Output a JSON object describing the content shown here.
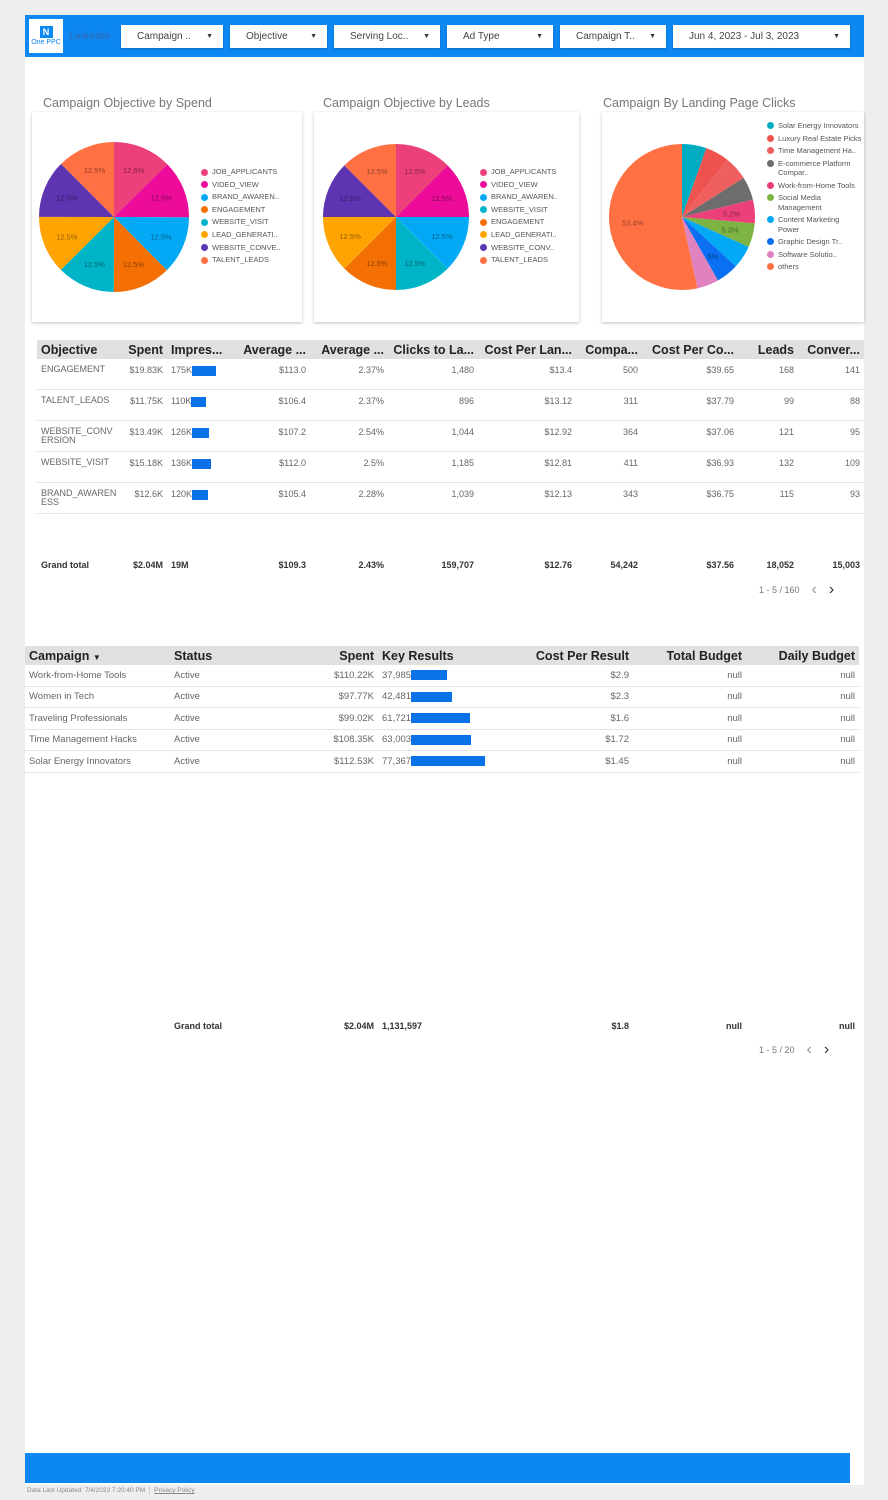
{
  "header": {
    "logo_text": "One PPC",
    "linkedin_text": "Linkedin",
    "filters": [
      "Campaign ..",
      "Objective",
      "Serving Loc..",
      "Ad Type",
      "Campaign T..",
      "Jun 4, 2023 - Jul 3, 2023"
    ],
    "brand_color": "#0d87f2"
  },
  "chart_data": [
    {
      "type": "pie",
      "title": "Campaign Objective by Spend",
      "slices": [
        {
          "label": "JOB_APPLICANTS",
          "value": 12.6,
          "display": "12.6%",
          "color": "#ec407a"
        },
        {
          "label": "VIDEO_VIEW",
          "value": 12.5,
          "display": "12.5%",
          "color": "#ec0c99"
        },
        {
          "label": "BRAND_AWAREN..",
          "value": 12.5,
          "display": "12.5%",
          "color": "#03a9f4"
        },
        {
          "label": "ENGAGEMENT",
          "value": 12.5,
          "display": "12.5%",
          "color": "#f57004"
        },
        {
          "label": "WEBSITE_VISIT",
          "value": 12.5,
          "display": "12.5%",
          "color": "#00b4c8"
        },
        {
          "label": "LEAD_GENERATI..",
          "value": 12.5,
          "display": "12.5%",
          "color": "#ffa402"
        },
        {
          "label": "WEBSITE_CONVE..",
          "value": 12.5,
          "display": "12.5%",
          "color": "#5e35b1"
        },
        {
          "label": "TALENT_LEADS",
          "value": 12.5,
          "display": "12.5%",
          "color": "#ff7043"
        }
      ]
    },
    {
      "type": "pie",
      "title": "Campaign Objective by Leads",
      "slices": [
        {
          "label": "JOB_APPLICANTS",
          "value": 12.5,
          "display": "12.5%",
          "color": "#ec407a"
        },
        {
          "label": "VIDEO_VIEW",
          "value": 12.5,
          "display": "12.5%",
          "color": "#ec0c99"
        },
        {
          "label": "BRAND_AWAREN..",
          "value": 12.5,
          "display": "12.5%",
          "color": "#03a9f4"
        },
        {
          "label": "WEBSITE_VISIT",
          "value": 12.5,
          "display": "12.5%",
          "color": "#00b4c8"
        },
        {
          "label": "ENGAGEMENT",
          "value": 12.5,
          "display": "12.5%",
          "color": "#f57004"
        },
        {
          "label": "LEAD_GENERATI..",
          "value": 12.5,
          "display": "12.5%",
          "color": "#ffa402"
        },
        {
          "label": "WEBSITE_CONV..",
          "value": 12.5,
          "display": "12.5%",
          "color": "#5e35b1"
        },
        {
          "label": "TALENT_LEADS",
          "value": 12.5,
          "display": "12.5%",
          "color": "#ff7043"
        }
      ]
    },
    {
      "type": "pie",
      "title": "Campaign By Landing Page Clicks",
      "slices": [
        {
          "label": "Solar Energy Innovators",
          "value": 5.4,
          "display": "",
          "color": "#00acc1"
        },
        {
          "label": "Luxury Real Estate Picks",
          "value": 5.3,
          "display": "",
          "color": "#ef5350"
        },
        {
          "label": "Time Management Ha..",
          "value": 5.3,
          "display": "",
          "color": "#ef5f5f"
        },
        {
          "label": "E-commerce Platform Compar..",
          "value": 5.2,
          "display": "",
          "color": "#6d6d6d"
        },
        {
          "label": "Work-from-Home Tools",
          "value": 5.2,
          "display": "5.2%",
          "color": "#ec407a"
        },
        {
          "label": "Social Media Management",
          "value": 5.3,
          "display": "5.3%",
          "color": "#7cb342"
        },
        {
          "label": "Content Marketing Power",
          "value": 5.1,
          "display": "",
          "color": "#03a9f4"
        },
        {
          "label": "Graphic Design Tr..",
          "value": 5.0,
          "display": "5%",
          "color": "#0a6ff0"
        },
        {
          "label": "Software Solutio..",
          "value": 4.8,
          "display": "",
          "color": "#e082c0"
        },
        {
          "label": "others",
          "value": 53.4,
          "display": "53.4%",
          "color": "#ff7043"
        }
      ]
    }
  ],
  "objective_table": {
    "headers": [
      "Objective",
      "Spent",
      "Impres...",
      "Average ...",
      "Average ...",
      "Clicks to La...",
      "Cost Per Lan...",
      "Compa...",
      "Cost Per Co...",
      "Leads",
      "Conver..."
    ],
    "rows": [
      {
        "objective": "ENGAGEMENT",
        "spent": "$19.83K",
        "impressions": "175K",
        "impressions_value": 175000,
        "avg1": "$113.0",
        "avg2": "2.37%",
        "clicks": "1,480",
        "cpl": "$13.4",
        "compa": "500",
        "cpc": "$39.65",
        "leads": "168",
        "conv": "141"
      },
      {
        "objective": "TALENT_LEADS",
        "spent": "$11.75K",
        "impressions": "110K",
        "impressions_value": 110000,
        "avg1": "$106.4",
        "avg2": "2.37%",
        "clicks": "896",
        "cpl": "$13.12",
        "compa": "311",
        "cpc": "$37.79",
        "leads": "99",
        "conv": "88"
      },
      {
        "objective": "WEBSITE_CONVERSION",
        "spent": "$13.49K",
        "impressions": "126K",
        "impressions_value": 126000,
        "avg1": "$107.2",
        "avg2": "2.54%",
        "clicks": "1,044",
        "cpl": "$12.92",
        "compa": "364",
        "cpc": "$37.06",
        "leads": "121",
        "conv": "95"
      },
      {
        "objective": "WEBSITE_VISIT",
        "spent": "$15.18K",
        "impressions": "136K",
        "impressions_value": 136000,
        "avg1": "$112.0",
        "avg2": "2.5%",
        "clicks": "1,185",
        "cpl": "$12.81",
        "compa": "411",
        "cpc": "$36.93",
        "leads": "132",
        "conv": "109"
      },
      {
        "objective": "BRAND_AWARENESS",
        "spent": "$12.6K",
        "impressions": "120K",
        "impressions_value": 120000,
        "avg1": "$105.4",
        "avg2": "2.28%",
        "clicks": "1,039",
        "cpl": "$12.13",
        "compa": "343",
        "cpc": "$36.75",
        "leads": "115",
        "conv": "93"
      }
    ],
    "total": {
      "label": "Grand total",
      "spent": "$2.04M",
      "impressions": "19M",
      "avg1": "$109.3",
      "avg2": "2.43%",
      "clicks": "159,707",
      "cpl": "$12.76",
      "compa": "54,242",
      "cpc": "$37.56",
      "leads": "18,052",
      "conv": "15,003"
    },
    "pagination": "1 - 5 / 160"
  },
  "campaign_table": {
    "headers": [
      "Campaign",
      "Status",
      "Spent",
      "Key Results",
      "Cost Per Result",
      "Total Budget",
      "Daily Budget"
    ],
    "sort_icon": "caret-down-icon",
    "rows": [
      {
        "campaign": "Work-from-Home Tools",
        "status": "Active",
        "spent": "$110.22K",
        "key": "37,985",
        "key_value": 37985,
        "cpr": "$2.9",
        "total": "null",
        "daily": "null"
      },
      {
        "campaign": "Women in Tech",
        "status": "Active",
        "spent": "$97.77K",
        "key": "42,481",
        "key_value": 42481,
        "cpr": "$2.3",
        "total": "null",
        "daily": "null"
      },
      {
        "campaign": "Traveling Professionals",
        "status": "Active",
        "spent": "$99.02K",
        "key": "61,721",
        "key_value": 61721,
        "cpr": "$1.6",
        "total": "null",
        "daily": "null"
      },
      {
        "campaign": "Time Management Hacks",
        "status": "Active",
        "spent": "$108.35K",
        "key": "63,003",
        "key_value": 63003,
        "cpr": "$1.72",
        "total": "null",
        "daily": "null"
      },
      {
        "campaign": "Solar Energy Innovators",
        "status": "Active",
        "spent": "$112.53K",
        "key": "77,367",
        "key_value": 77367,
        "cpr": "$1.45",
        "total": "null",
        "daily": "null"
      }
    ],
    "total": {
      "label": "Grand total",
      "spent": "$2.04M",
      "key": "1,131,597",
      "cpr": "$1.8",
      "total": "null",
      "daily": "null"
    },
    "pagination": "1 - 5 / 20"
  },
  "footer": {
    "updated": "Data Last Updated: 7/4/2023 7:20:40 PM",
    "privacy": "Privacy Policy"
  }
}
